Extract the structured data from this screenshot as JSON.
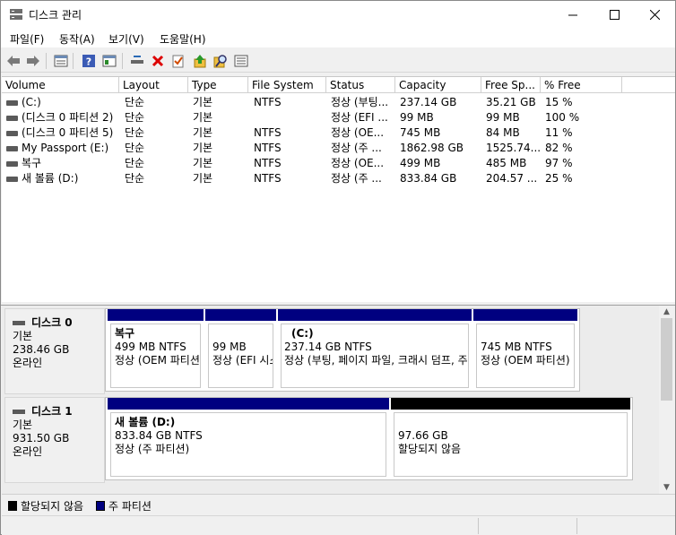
{
  "window": {
    "title": "디스크 관리"
  },
  "menu": [
    {
      "label": "파일(F)"
    },
    {
      "label": "동작(A)"
    },
    {
      "label": "보기(V)"
    },
    {
      "label": "도움말(H)"
    }
  ],
  "toolbar_icons": [
    "back-icon",
    "forward-icon",
    "properties-icon",
    "help-icon",
    "show-hide-console-icon",
    "connect-icon",
    "delete-icon",
    "check-icon",
    "up-icon",
    "search-icon",
    "list-icon"
  ],
  "columns": [
    "Volume",
    "Layout",
    "Type",
    "File System",
    "Status",
    "Capacity",
    "Free Sp...",
    "% Free"
  ],
  "volumes": [
    {
      "volume": "(C:)",
      "layout": "단순",
      "type": "기본",
      "fs": "NTFS",
      "status": "정상 (부팅...",
      "capacity": "237.14 GB",
      "free": "35.21 GB",
      "pct": "15 %"
    },
    {
      "volume": "(디스크 0 파티션 2)",
      "layout": "단순",
      "type": "기본",
      "fs": "",
      "status": "정상 (EFI ...",
      "capacity": "99 MB",
      "free": "99 MB",
      "pct": "100 %"
    },
    {
      "volume": "(디스크 0 파티션 5)",
      "layout": "단순",
      "type": "기본",
      "fs": "NTFS",
      "status": "정상 (OE...",
      "capacity": "745 MB",
      "free": "84 MB",
      "pct": "11 %"
    },
    {
      "volume": "My Passport (E:)",
      "layout": "단순",
      "type": "기본",
      "fs": "NTFS",
      "status": "정상 (주 ...",
      "capacity": "1862.98 GB",
      "free": "1525.74...",
      "pct": "82 %"
    },
    {
      "volume": "복구",
      "layout": "단순",
      "type": "기본",
      "fs": "NTFS",
      "status": "정상 (OE...",
      "capacity": "499 MB",
      "free": "485 MB",
      "pct": "97 %"
    },
    {
      "volume": "새 볼륨 (D:)",
      "layout": "단순",
      "type": "기본",
      "fs": "NTFS",
      "status": "정상 (주 ...",
      "capacity": "833.84 GB",
      "free": "204.57 ...",
      "pct": "25 %"
    }
  ],
  "disks": [
    {
      "name": "디스크 0",
      "type": "기본",
      "size": "238.46 GB",
      "state": "온라인",
      "partitions": [
        {
          "name": "복구",
          "size": "499 MB NTFS",
          "status": "정상 (OEM 파티션)",
          "bar": "#000080"
        },
        {
          "name": "",
          "size": "99 MB",
          "status": "정상 (EFI 시스템 파티션)",
          "bar": "#000080"
        },
        {
          "name": "(C:)",
          "size": "237.14 GB NTFS",
          "status": "정상 (부팅, 페이지 파일, 크래시 덤프, 주 파티션)",
          "bar": "#000080"
        },
        {
          "name": "",
          "size": "745 MB NTFS",
          "status": "정상 (OEM 파티션)",
          "bar": "#000080"
        }
      ]
    },
    {
      "name": "디스크 1",
      "type": "기본",
      "size": "931.50 GB",
      "state": "온라인",
      "partitions": [
        {
          "name": "새 볼륨  (D:)",
          "size": "833.84 GB NTFS",
          "status": "정상 (주 파티션)",
          "bar": "#000080"
        },
        {
          "name": "",
          "size": "97.66 GB",
          "status": "할당되지 않음",
          "bar": "#000000"
        }
      ]
    }
  ],
  "legend": [
    {
      "label": "할당되지 않음",
      "color": "#000000"
    },
    {
      "label": "주 파티션",
      "color": "#000080"
    }
  ]
}
